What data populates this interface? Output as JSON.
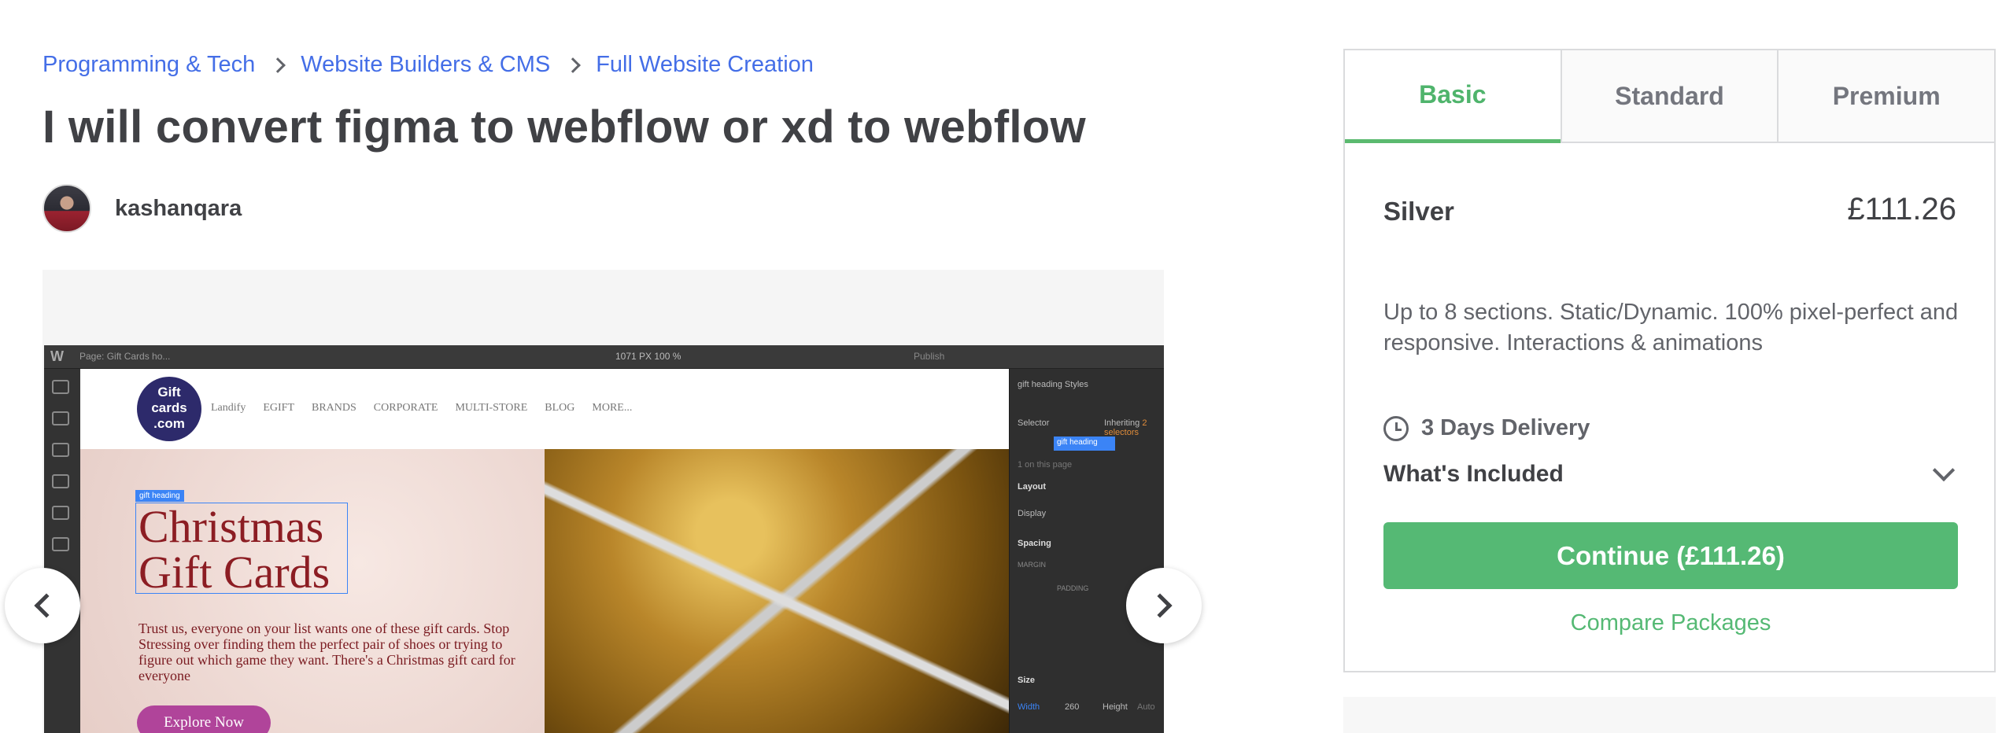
{
  "breadcrumb": {
    "items": [
      "Programming & Tech",
      "Website Builders & CMS",
      "Full Website Creation"
    ]
  },
  "gig": {
    "title": "I will convert figma to webflow or xd to webflow"
  },
  "seller": {
    "name": "kashanqara"
  },
  "gallery": {
    "screenshot": {
      "app_logo": "W",
      "page_label": "Page: Gift Cards ho...",
      "viewport": "1071 PX  100 %",
      "publish": "Publish",
      "site_logo": [
        "Gift",
        "cards",
        ".com"
      ],
      "menu": [
        "Landify",
        "EGIFT",
        "BRANDS",
        "CORPORATE",
        "MULTI-STORE",
        "BLOG",
        "MORE..."
      ],
      "selection_tag": "gift heading",
      "hero_heading": [
        "Christmas",
        "Gift Cards"
      ],
      "hero_text": "Trust us, everyone on your list wants one of these gift cards. Stop Stressing over finding them the perfect pair of shoes or trying to figure out which game they want. There's a Christmas gift card for everyone",
      "explore_button": "Explore Now",
      "panel": {
        "styles_title": "gift heading Styles",
        "selector_label": "Selector",
        "inheriting": "Inheriting",
        "inheriting_count": "2 selectors",
        "selector_chip": "gift heading",
        "on_page": "1 on this page",
        "layout": "Layout",
        "display": "Display",
        "spacing": "Spacing",
        "margin": "MARGIN",
        "padding": "PADDING",
        "size": "Size",
        "width_label": "Width",
        "width_value": "260",
        "height_label": "Height",
        "height_value": "Auto"
      }
    }
  },
  "package": {
    "tabs": [
      "Basic",
      "Standard",
      "Premium"
    ],
    "active_tab": "Basic",
    "name": "Silver",
    "price": "£111.26",
    "description": "Up to 8 sections. Static/Dynamic. 100% pixel-perfect and responsive. Interactions & animations",
    "delivery": "3 Days Delivery",
    "included_label": "What's Included",
    "continue_label": "Continue (£111.26)",
    "compare_label": "Compare Packages"
  },
  "colors": {
    "link": "#446ee7",
    "accent_green": "#55b974",
    "text": "#404145"
  },
  "icons": {
    "breadcrumb_separator": "chevron-right-icon",
    "delivery": "clock-icon",
    "included": "chevron-down-icon",
    "gallery_prev": "chevron-left-icon",
    "gallery_next": "chevron-right-icon"
  }
}
